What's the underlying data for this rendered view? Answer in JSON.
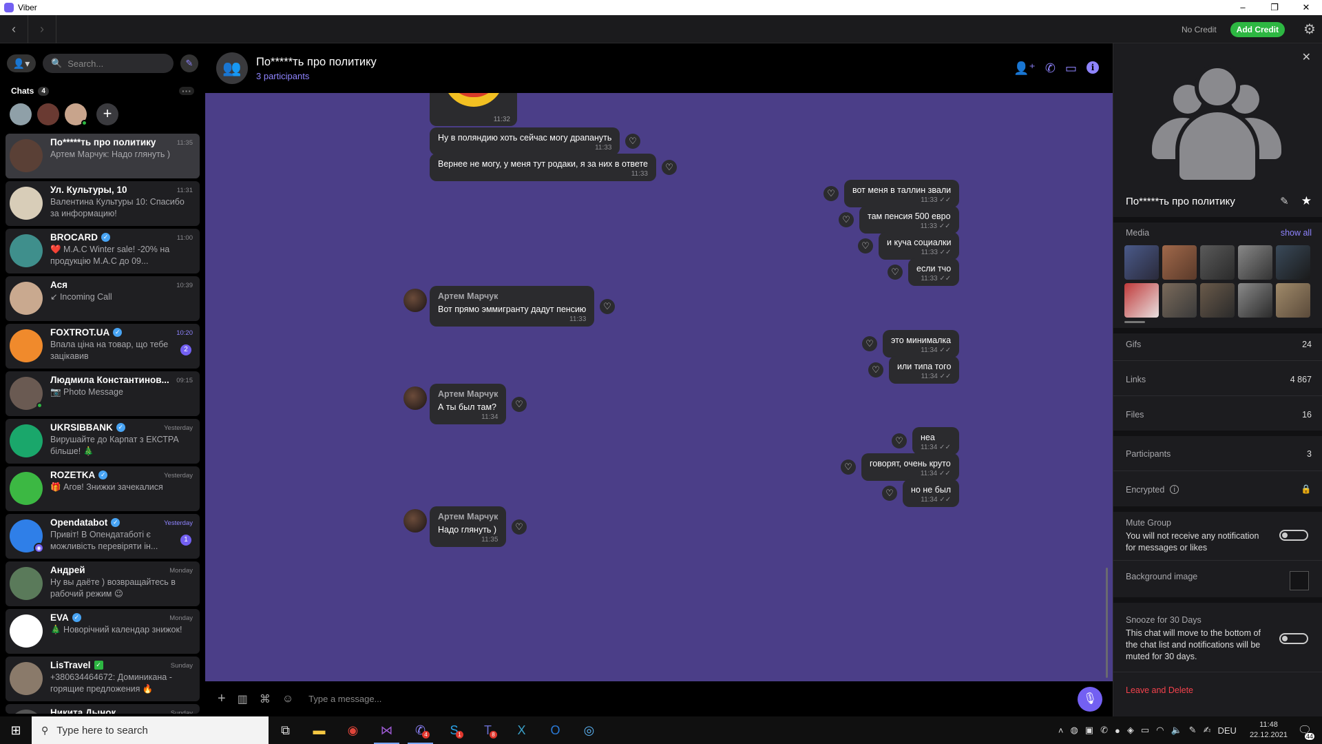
{
  "window": {
    "title": "Viber",
    "controls": [
      "–",
      "❐",
      "✕"
    ]
  },
  "nav": {
    "back": "‹",
    "forward": "›",
    "no_credit": "No Credit",
    "add_credit": "Add Credit"
  },
  "sidebar": {
    "search_placeholder": "Search...",
    "chats_label": "Chats",
    "chats_count": "4",
    "chats": [
      {
        "name": "По*****ть про политику",
        "preview": "Артем Марчук: Надо глянуть )",
        "time": "11:35",
        "selected": true,
        "avatar_color": "#5a4036"
      },
      {
        "name": "Ул. Культуры, 10",
        "preview": "Валентина Культуры 10: Спасибо за информацию!",
        "time": "11:31",
        "avatar_color": "#d8cdb8"
      },
      {
        "name": "BROCARD",
        "verified": true,
        "preview": "❤️ M.A.C Winter sale! -20% на продукцію M.A.C до 09...",
        "time": "11:00",
        "avatar_color": "#3f8f8c"
      },
      {
        "name": "Ася",
        "preview": "↙ Incoming Call",
        "time": "10:39",
        "avatar_color": "#c9a98f"
      },
      {
        "name": "FOXTROT.UA",
        "verified": true,
        "preview": "Впала ціна на товар, що тебе зацікавив",
        "time": "10:20",
        "time_highlight": true,
        "unread": "2",
        "avatar_color": "#f08a2c"
      },
      {
        "name": "Людмила Константинов...",
        "preview": "📷 Photo Message",
        "time": "09:15",
        "online": true,
        "avatar_color": "#6a5a52"
      },
      {
        "name": "UKRSIBBANK",
        "verified": true,
        "preview": "Вирушайте до Карпат з ЕКСТРА більше! 🎄",
        "time": "Yesterday",
        "avatar_color": "#1aa76b"
      },
      {
        "name": "ROZETKA",
        "verified": true,
        "preview": "🎁 Агов! Знижки зачекалися",
        "time": "Yesterday",
        "avatar_color": "#3cb843"
      },
      {
        "name": "Opendatabot",
        "verified": true,
        "preview": "Привіт! В Опендатаботі є можливість перевіряти ін...",
        "time": "Yesterday",
        "time_highlight": true,
        "unread": "1",
        "bot": true,
        "avatar_color": "#2f7fe8"
      },
      {
        "name": "Андрей",
        "preview": "Ну вы даёте ) возвращайтесь в рабочий режим 😉",
        "time": "Monday",
        "avatar_color": "#5a7a5a"
      },
      {
        "name": "EVA",
        "verified": true,
        "preview": "🎄 Новорічний календар знижок!",
        "time": "Monday",
        "avatar_color": "#ffffff"
      },
      {
        "name": "LisTravel",
        "verified_green": true,
        "preview": "+380634464672: Доминикана - горящие предложения 🔥",
        "time": "Sunday",
        "avatar_color": "#8a7a6a"
      },
      {
        "name": "Никита Дынок",
        "preview": "",
        "time": "Sunday",
        "avatar_color": "#555555"
      }
    ]
  },
  "chat": {
    "title": "По*****ть про политику",
    "subtitle": "3 participants",
    "sticker_time": "11:32",
    "messages": [
      {
        "text": "Ну в поляндию хоть сейчас могу драпануть",
        "time": "11:33"
      },
      {
        "text": "Вернее не могу, у меня тут родаки, я за них в ответе",
        "time": "11:33"
      },
      {
        "text": "вот меня в таллин звали",
        "time": "11:33 ✓✓"
      },
      {
        "text": "там пенсия 500 евро",
        "time": "11:33 ✓✓"
      },
      {
        "text": "и куча социалки",
        "time": "11:33 ✓✓"
      },
      {
        "text": "если тчо",
        "time": "11:33 ✓✓"
      },
      {
        "sender": "Артем Марчук",
        "text": "Вот прямо эммигранту дадут пенсию",
        "time": "11:33"
      },
      {
        "text": "это минималка",
        "time": "11:34 ✓✓"
      },
      {
        "text": "или типа того",
        "time": "11:34 ✓✓"
      },
      {
        "sender": "Артем Марчук",
        "text": "А ты был там?",
        "time": "11:34"
      },
      {
        "text": "неа",
        "time": "11:34 ✓✓"
      },
      {
        "text": "говорят, очень круто",
        "time": "11:34 ✓✓"
      },
      {
        "text": "но не был",
        "time": "11:34 ✓✓"
      },
      {
        "sender": "Артем Марчук",
        "text": "Надо глянуть )",
        "time": "11:35"
      }
    ],
    "composer_placeholder": "Type a message..."
  },
  "info": {
    "name": "По*****ть про политику",
    "media_label": "Media",
    "show_all": "show all",
    "gifs_label": "Gifs",
    "gifs_value": "24",
    "links_label": "Links",
    "links_value": "4 867",
    "files_label": "Files",
    "files_value": "16",
    "participants_label": "Participants",
    "participants_value": "3",
    "encrypted_label": "Encrypted",
    "mute_title": "Mute Group",
    "mute_desc": "You will not receive any notification for messages or likes",
    "background_label": "Background image",
    "snooze_title": "Snooze for 30 Days",
    "snooze_desc": "This chat will move to the bottom of the chat list and notifications will be muted for 30 days.",
    "leave": "Leave and Delete"
  },
  "taskbar": {
    "search_placeholder": "Type here to search",
    "lang": "DEU",
    "time": "11:48",
    "date": "22.12.2021",
    "notifications": "44",
    "badges": {
      "viber": "4",
      "skype": "1",
      "teams": "8"
    }
  }
}
